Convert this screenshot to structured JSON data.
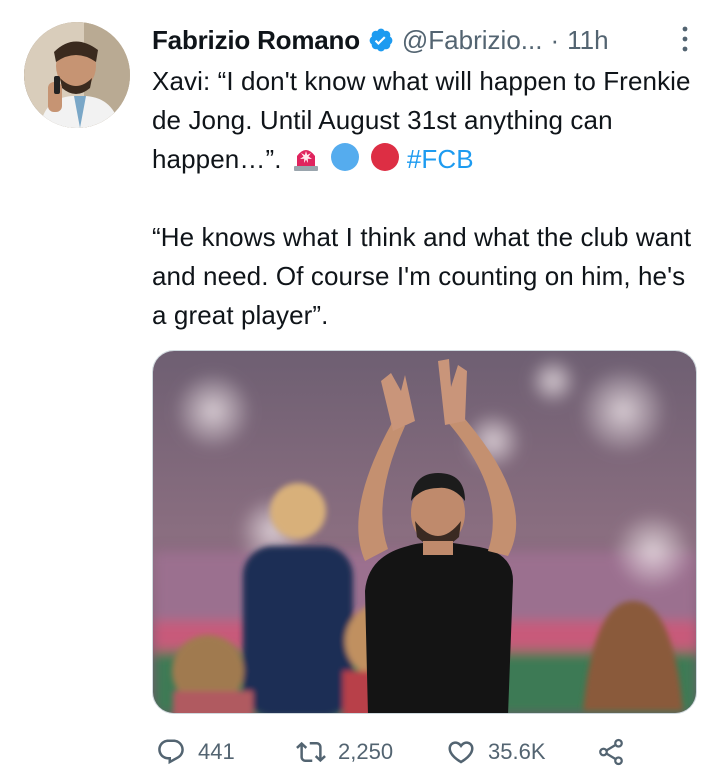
{
  "author": {
    "name": "Fabrizio Romano",
    "handle": "@Fabrizio...",
    "separator": "·",
    "time": "11h",
    "verified": true
  },
  "tweet": {
    "paragraph1_text": "Xavi: “I don't know what will happen to Frenkie de Jong. Until August 31st anything can happen…”.",
    "hashtag": "#FCB",
    "emojis": [
      "rotating-light-icon",
      "blue-circle-icon",
      "red-circle-icon"
    ],
    "paragraph2_text": "“He knows what I think and what the club want and need. Of course I'm counting on him, he's a great player”."
  },
  "media": {
    "icon": "photo-xavi-applauding"
  },
  "actions": {
    "reply_count": "441",
    "retweet_count": "2,250",
    "like_count": "35.6K"
  },
  "colors": {
    "text": "#0f1419",
    "secondary": "#536471",
    "link": "#1d9bf0",
    "verified": "#1d9bf0"
  }
}
